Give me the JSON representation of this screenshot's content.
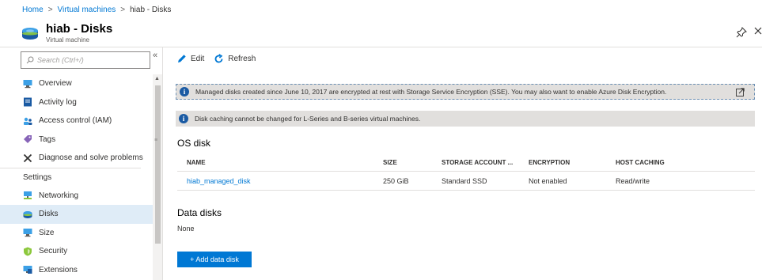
{
  "breadcrumb": {
    "items": [
      "Home",
      "Virtual machines",
      "hiab - Disks"
    ],
    "separator": ">"
  },
  "blade": {
    "title": "hiab - Disks",
    "subtitle": "Virtual machine",
    "icon": "disk-icon",
    "pin_icon": "pin-icon",
    "close_icon": "close-icon"
  },
  "search": {
    "placeholder": "Search (Ctrl+/)",
    "collapse_glyph": "«"
  },
  "menu": {
    "items": [
      {
        "label": "Overview",
        "icon": "overview-icon"
      },
      {
        "label": "Activity log",
        "icon": "activity-log-icon"
      },
      {
        "label": "Access control (IAM)",
        "icon": "access-control-icon"
      },
      {
        "label": "Tags",
        "icon": "tag-icon"
      },
      {
        "label": "Diagnose and solve problems",
        "icon": "wrench-icon"
      }
    ],
    "section_label": "Settings",
    "settings_items": [
      {
        "label": "Networking",
        "icon": "networking-icon"
      },
      {
        "label": "Disks",
        "icon": "disk-icon",
        "active": true
      },
      {
        "label": "Size",
        "icon": "size-icon"
      },
      {
        "label": "Security",
        "icon": "shield-icon"
      },
      {
        "label": "Extensions",
        "icon": "extensions-icon"
      }
    ]
  },
  "toolbar": {
    "edit_label": "Edit",
    "refresh_label": "Refresh"
  },
  "notices": {
    "encryption": "Managed disks created since June 10, 2017 are encrypted at rest with Storage Service Encryption (SSE). You may also want to enable Azure Disk Encryption.",
    "caching": "Disk caching cannot be changed for L-Series and B-series virtual machines."
  },
  "os_disk": {
    "title": "OS disk",
    "columns": [
      "NAME",
      "SIZE",
      "STORAGE ACCOUNT ...",
      "ENCRYPTION",
      "HOST CACHING"
    ],
    "rows": [
      {
        "name": "hiab_managed_disk",
        "size": "250 GiB",
        "storage": "Standard SSD",
        "encryption": "Not enabled",
        "caching": "Read/write"
      }
    ]
  },
  "data_disks": {
    "title": "Data disks",
    "empty_text": "None",
    "add_label": "+ Add data disk"
  },
  "colors": {
    "accent": "#0078d4",
    "active_menu": "#dfecf7",
    "notice_bg": "#e1dfdd"
  }
}
